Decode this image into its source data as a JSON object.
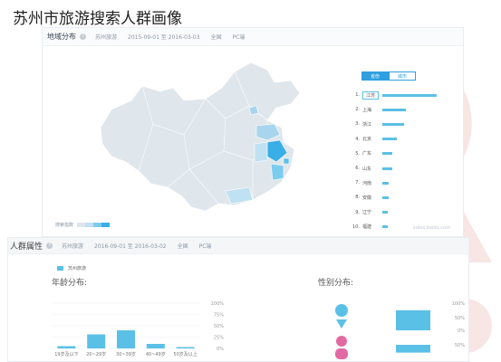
{
  "slide_title": "苏州市旅游搜索人群画像",
  "map_panel": {
    "title": "地域分布",
    "help_icon": "question-icon",
    "keyword": "苏州旅游",
    "date_range": "2015-09-01 至 2016-03-03",
    "region": "全国",
    "device": "PC端",
    "toggle": [
      "省份",
      "城市"
    ],
    "legend_label": "搜索指数",
    "ranking": [
      {
        "rank": "1.",
        "name": "江苏",
        "value": 100
      },
      {
        "rank": "2.",
        "name": "上海",
        "value": 44
      },
      {
        "rank": "3.",
        "name": "浙江",
        "value": 40
      },
      {
        "rank": "4.",
        "name": "北京",
        "value": 26
      },
      {
        "rank": "5.",
        "name": "广东",
        "value": 19
      },
      {
        "rank": "6.",
        "name": "山东",
        "value": 18
      },
      {
        "rank": "7.",
        "name": "河南",
        "value": 12
      },
      {
        "rank": "8.",
        "name": "安徽",
        "value": 12
      },
      {
        "rank": "9.",
        "name": "辽宁",
        "value": 10
      },
      {
        "rank": "10.",
        "name": "福建",
        "value": 10
      }
    ],
    "site_mark": "index.baidu.com"
  },
  "crowd_panel": {
    "title": "人群属性",
    "help_icon": "question-icon",
    "keyword": "苏州旅游",
    "date_range": "2016-09-01 至 2016-03-02",
    "region": "全国",
    "device": "PC端",
    "series_label": "苏州旅游"
  },
  "chart_data": [
    {
      "type": "bar",
      "title": "年龄分布:",
      "categories": [
        "19岁及以下",
        "20~29岁",
        "30~39岁",
        "40~49岁",
        "50岁及以上"
      ],
      "values": [
        5,
        31,
        40,
        10,
        3
      ],
      "yticks": [
        "100%",
        "75%",
        "50%",
        "25%",
        "0%"
      ],
      "ylim": [
        0,
        100
      ],
      "color": "#5bc0e6"
    },
    {
      "type": "bar",
      "title": "性别分布:",
      "categories": [
        "男",
        "女"
      ],
      "values": [
        72,
        28
      ],
      "yticks": [
        "100%",
        "50%",
        "0%",
        "50%"
      ],
      "color": "#5bc0e6",
      "icons": [
        "male-icon",
        "female-icon"
      ]
    }
  ]
}
